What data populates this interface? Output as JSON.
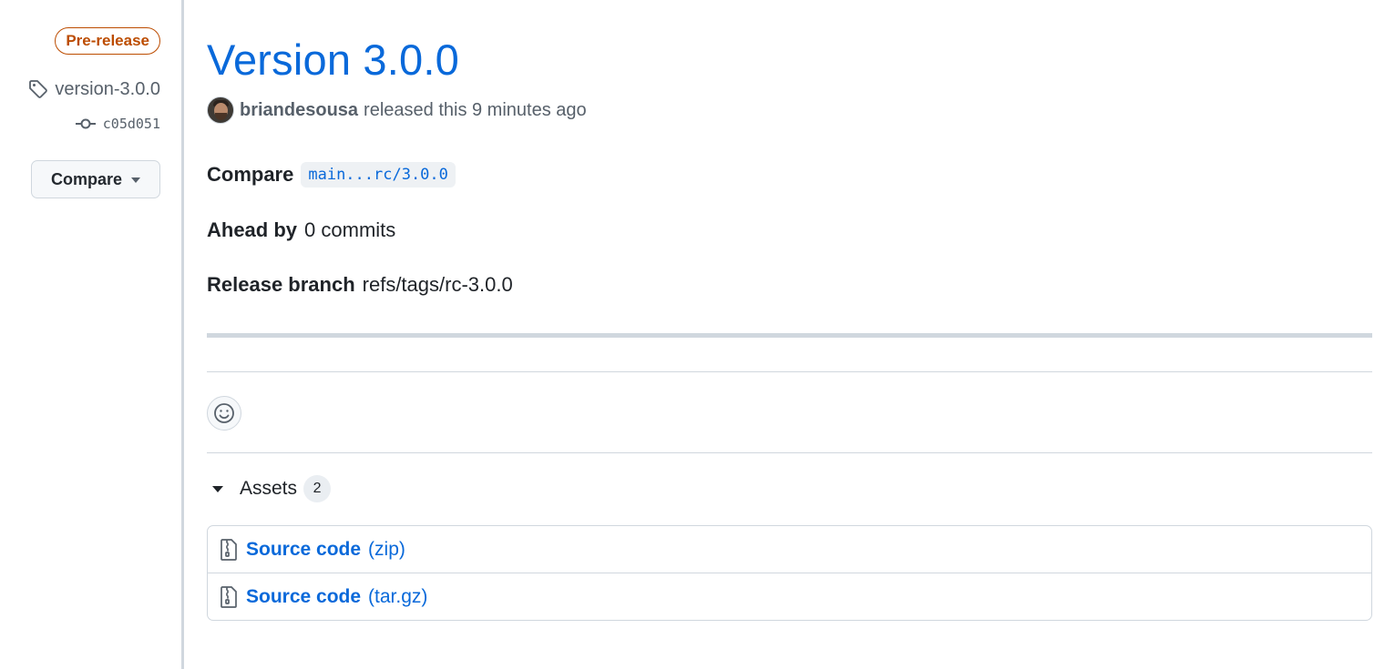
{
  "sidebar": {
    "badge": "Pre-release",
    "tag": "version-3.0.0",
    "commit_sha": "c05d051",
    "compare_button": "Compare"
  },
  "release": {
    "title": "Version 3.0.0",
    "author": "briandesousa",
    "released_text": "released this 9 minutes ago",
    "compare_label": "Compare",
    "compare_range": "main...rc/3.0.0",
    "ahead_label": "Ahead by",
    "ahead_value": "0 commits",
    "branch_label": "Release branch",
    "branch_value": "refs/tags/rc-3.0.0"
  },
  "assets": {
    "heading": "Assets",
    "count": "2",
    "items": [
      {
        "name": "Source code",
        "ext": "(zip)"
      },
      {
        "name": "Source code",
        "ext": "(tar.gz)"
      }
    ]
  },
  "icons": {
    "tag": "tag-icon",
    "commit": "git-commit-icon",
    "caret": "triangle-down-icon",
    "emoji": "smiley-icon",
    "archive": "file-zip-icon"
  },
  "colors": {
    "accent": "#0969da",
    "prerelease": "#bc4c00",
    "border": "#d0d7de",
    "muted": "#57606a"
  }
}
